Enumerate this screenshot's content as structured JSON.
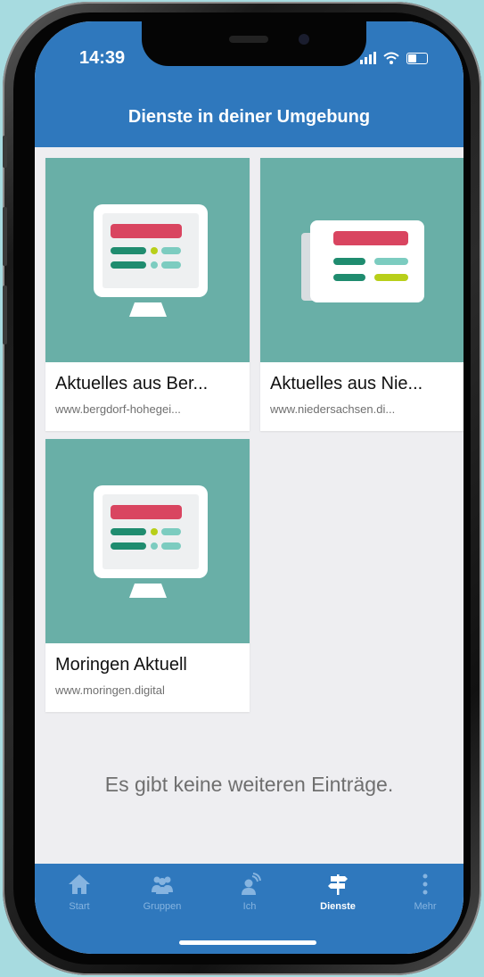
{
  "status_bar": {
    "time": "14:39"
  },
  "header": {
    "title": "Dienste in deiner Umgebung"
  },
  "cards": [
    {
      "title": "Aktuelles aus Ber...",
      "url": "www.bergdorf-hohegei...",
      "icon": "monitor-icon"
    },
    {
      "title": "Aktuelles aus Nie...",
      "url": "www.niedersachsen.di...",
      "icon": "newspaper-icon"
    },
    {
      "title": "Moringen Aktuell",
      "url": "www.moringen.digital",
      "icon": "monitor-icon"
    }
  ],
  "empty_message": "Es gibt keine weiteren Einträge.",
  "tabbar": {
    "active": "Dienste",
    "items": [
      {
        "label": "Start",
        "icon": "home-icon"
      },
      {
        "label": "Gruppen",
        "icon": "group-icon"
      },
      {
        "label": "Ich",
        "icon": "person-icon"
      },
      {
        "label": "Dienste",
        "icon": "signpost-icon"
      },
      {
        "label": "Mehr",
        "icon": "more-icon"
      }
    ]
  },
  "colors": {
    "primary": "#2f78bd",
    "card_thumb": "#69afa7",
    "accent_red": "#d94560",
    "accent_green": "#1f8c6f",
    "accent_teal": "#7cccc0",
    "accent_lime": "#b8cf1a"
  }
}
